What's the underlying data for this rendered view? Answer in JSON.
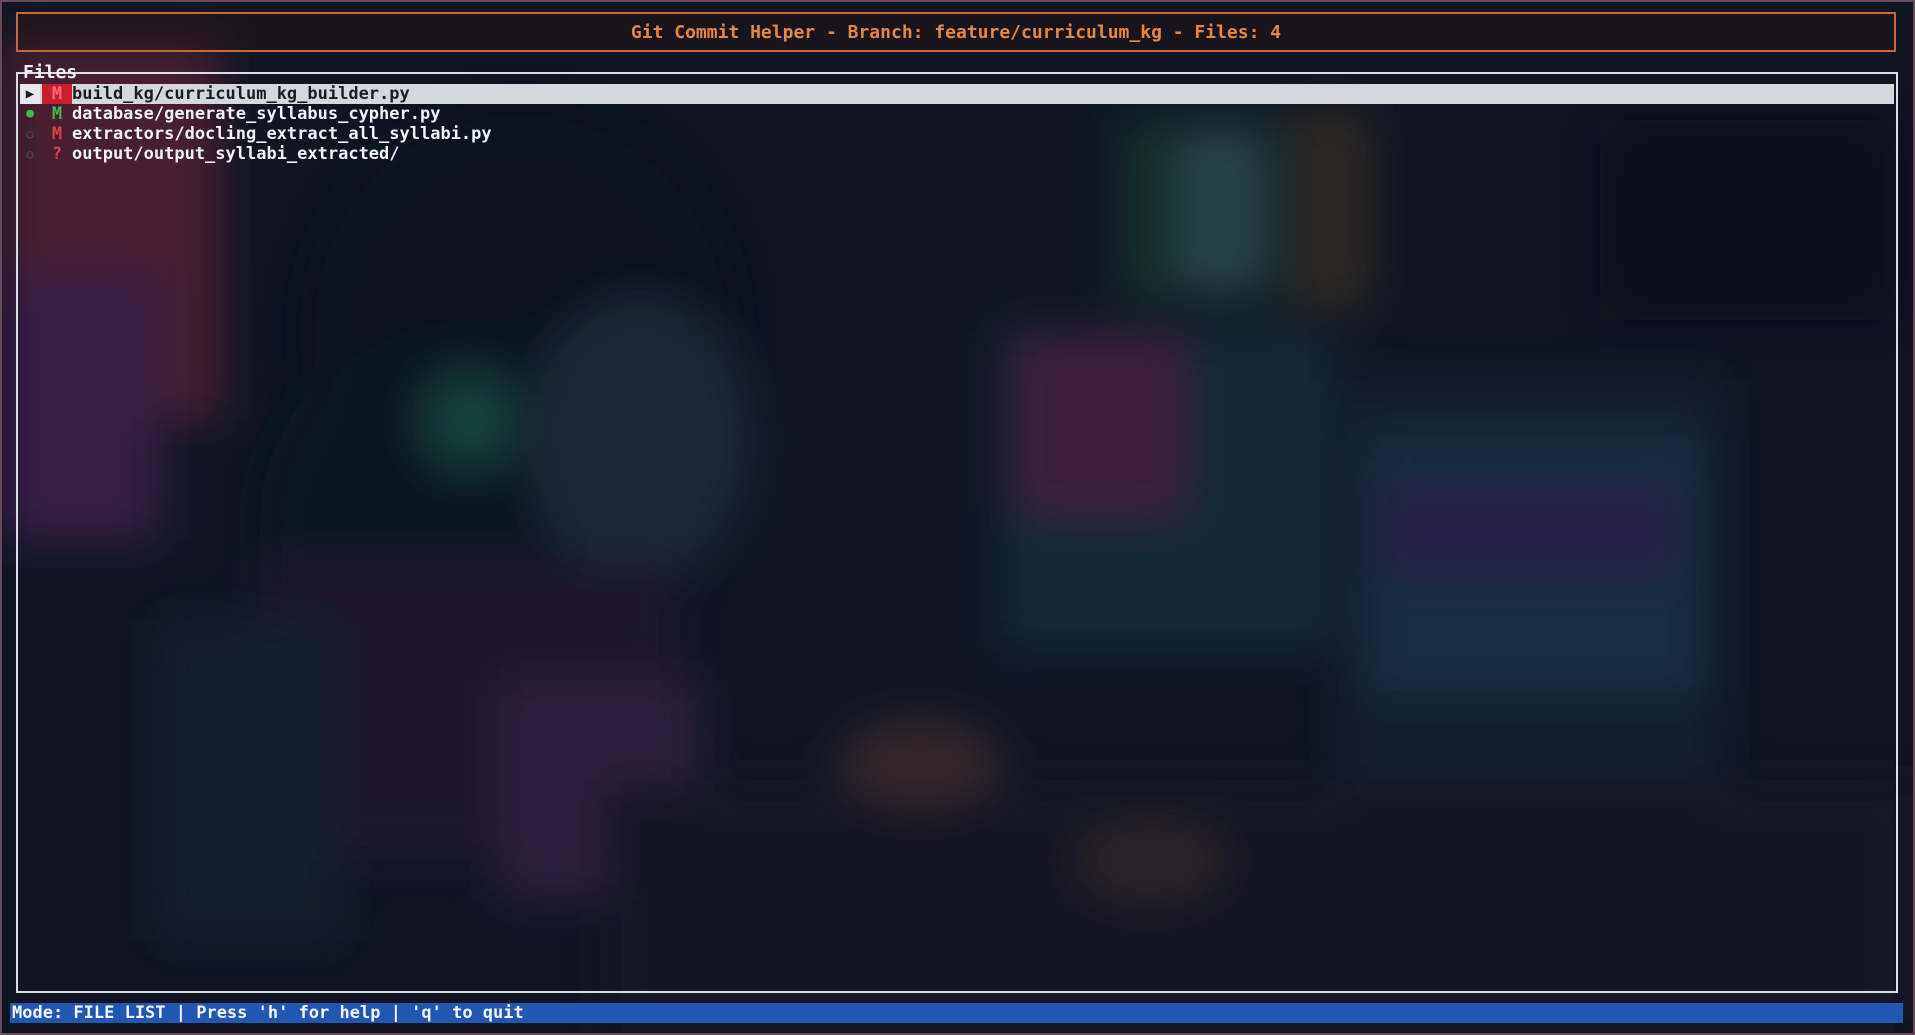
{
  "window": {
    "title": "Git Commit Helper - Branch: feature/curriculum_kg - Files: 4"
  },
  "panel": {
    "label": "Files"
  },
  "files": [
    {
      "marker": "▶",
      "status": "M",
      "path": "build_kg/curriculum_kg_builder.py"
    },
    {
      "marker": "●",
      "status": "M",
      "path": "database/generate_syllabus_cypher.py"
    },
    {
      "marker": "○",
      "status": "M",
      "path": "extractors/docling_extract_all_syllabi.py"
    },
    {
      "marker": "○",
      "status": "?",
      "path": "output/output_syllabi_extracted/"
    }
  ],
  "status_bar": {
    "text": "Mode: FILE LIST | Press 'h' for help | 'q' to quit"
  },
  "colors": {
    "accent_orange": "#e6883f",
    "selected_bg": "#d6d7dd",
    "modified_red": "#e23b4a",
    "staged_green": "#3fb950",
    "status_bar_blue": "#1f57b3"
  }
}
